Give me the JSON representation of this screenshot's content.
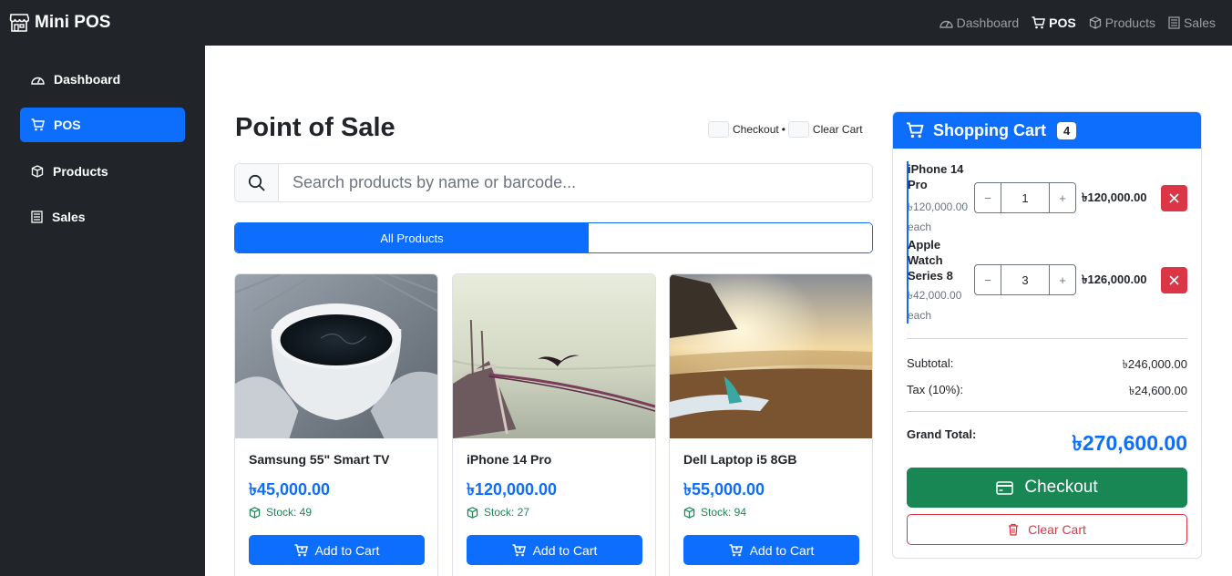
{
  "app": {
    "brand": "Mini POS"
  },
  "top_nav": [
    {
      "label": "Dashboard",
      "icon": "speedometer-icon",
      "active": false
    },
    {
      "label": "POS",
      "icon": "cart-icon",
      "active": true
    },
    {
      "label": "Products",
      "icon": "box-icon",
      "active": false
    },
    {
      "label": "Sales",
      "icon": "receipt-icon",
      "active": false
    }
  ],
  "sidebar": {
    "items": [
      {
        "label": "Dashboard",
        "icon": "speedometer-icon",
        "active": false
      },
      {
        "label": "POS",
        "icon": "cart-icon",
        "active": true
      },
      {
        "label": "Products",
        "icon": "box-icon",
        "active": false
      },
      {
        "label": "Sales",
        "icon": "receipt-icon",
        "active": false
      }
    ]
  },
  "main": {
    "title": "Point of Sale",
    "shortcuts": {
      "checkout": "Checkout",
      "separator": "•",
      "clear": "Clear Cart"
    },
    "search": {
      "placeholder": "Search products by name or barcode..."
    },
    "tabs": [
      {
        "label": "All Products",
        "active": true
      }
    ],
    "products": [
      {
        "name": "Samsung 55\" Smart TV",
        "price": "৳45,000.00",
        "stock": "Stock: 49",
        "add_label": "Add to Cart",
        "image": "coffee-cup-photo"
      },
      {
        "name": "iPhone 14 Pro",
        "price": "৳120,000.00",
        "stock": "Stock: 27",
        "add_label": "Add to Cart",
        "image": "boat-bird-photo"
      },
      {
        "name": "Dell Laptop i5 8GB",
        "price": "৳55,000.00",
        "stock": "Stock: 94",
        "add_label": "Add to Cart",
        "image": "beach-surfboard-photo"
      }
    ]
  },
  "cart": {
    "title": "Shopping Cart",
    "count": "4",
    "items": [
      {
        "name_lines": [
          "iPhone 14",
          "Pro"
        ],
        "each_lines": [
          "৳120,000.00",
          "each"
        ],
        "qty": "1",
        "total": "৳120,000.00"
      },
      {
        "name_lines": [
          "Apple",
          "Watch",
          "Series 8"
        ],
        "each_lines": [
          "৳42,000.00",
          "each"
        ],
        "qty": "3",
        "total": "৳126,000.00"
      }
    ],
    "subtotal_label": "Subtotal:",
    "subtotal": "৳246,000.00",
    "tax_label": "Tax (10%):",
    "tax": "৳24,600.00",
    "grand_label": "Grand Total:",
    "grand_total": "৳270,600.00",
    "checkout_label": "Checkout",
    "clear_label": "Clear Cart"
  },
  "colors": {
    "primary": "#0d6efd",
    "success": "#198754",
    "danger": "#dc3545",
    "dark": "#212529"
  }
}
